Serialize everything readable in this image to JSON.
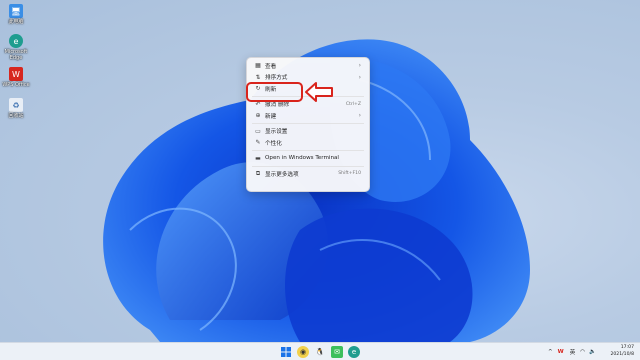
{
  "desktop": {
    "icons": [
      {
        "label": "此电脑",
        "icon": "computer-icon",
        "color": "#3a8ee6"
      },
      {
        "label": "Microsoft Edge",
        "icon": "edge-icon",
        "color": "#1f9d8f"
      },
      {
        "label": "WPS Office",
        "icon": "wps-icon",
        "color": "#d7261e"
      },
      {
        "label": "回收站",
        "icon": "recycle-bin-icon",
        "color": "#6c9bd2"
      }
    ]
  },
  "context_menu": {
    "items": [
      {
        "label": "查看",
        "icon": "grid-icon",
        "shortcut": "",
        "submenu": true
      },
      {
        "label": "排序方式",
        "icon": "sort-icon",
        "shortcut": "",
        "submenu": true
      },
      {
        "label": "刷新",
        "icon": "refresh-icon",
        "shortcut": "",
        "submenu": false
      },
      {
        "label": "撤消 删除",
        "icon": "undo-icon",
        "shortcut": "Ctrl+Z",
        "submenu": false
      },
      {
        "label": "新建",
        "icon": "new-icon",
        "shortcut": "",
        "submenu": true
      },
      {
        "label": "显示设置",
        "icon": "display-icon",
        "shortcut": "",
        "submenu": false
      },
      {
        "label": "个性化",
        "icon": "brush-icon",
        "shortcut": "",
        "submenu": false
      },
      {
        "label": "Open in Windows Terminal",
        "icon": "terminal-icon",
        "shortcut": "",
        "submenu": false
      },
      {
        "label": "显示更多选项",
        "icon": "more-options-icon",
        "shortcut": "Shift+F10",
        "submenu": false
      }
    ]
  },
  "annotation": {
    "color": "#d9241c"
  },
  "taskbar": {
    "tray": {
      "ime": "英",
      "wps_label": "W"
    },
    "clock": {
      "time": "17:07",
      "date": "2021/10/8"
    }
  },
  "colors": {
    "accent": "#1f63e6",
    "wallpaper_bg": "#b8cbe3"
  }
}
